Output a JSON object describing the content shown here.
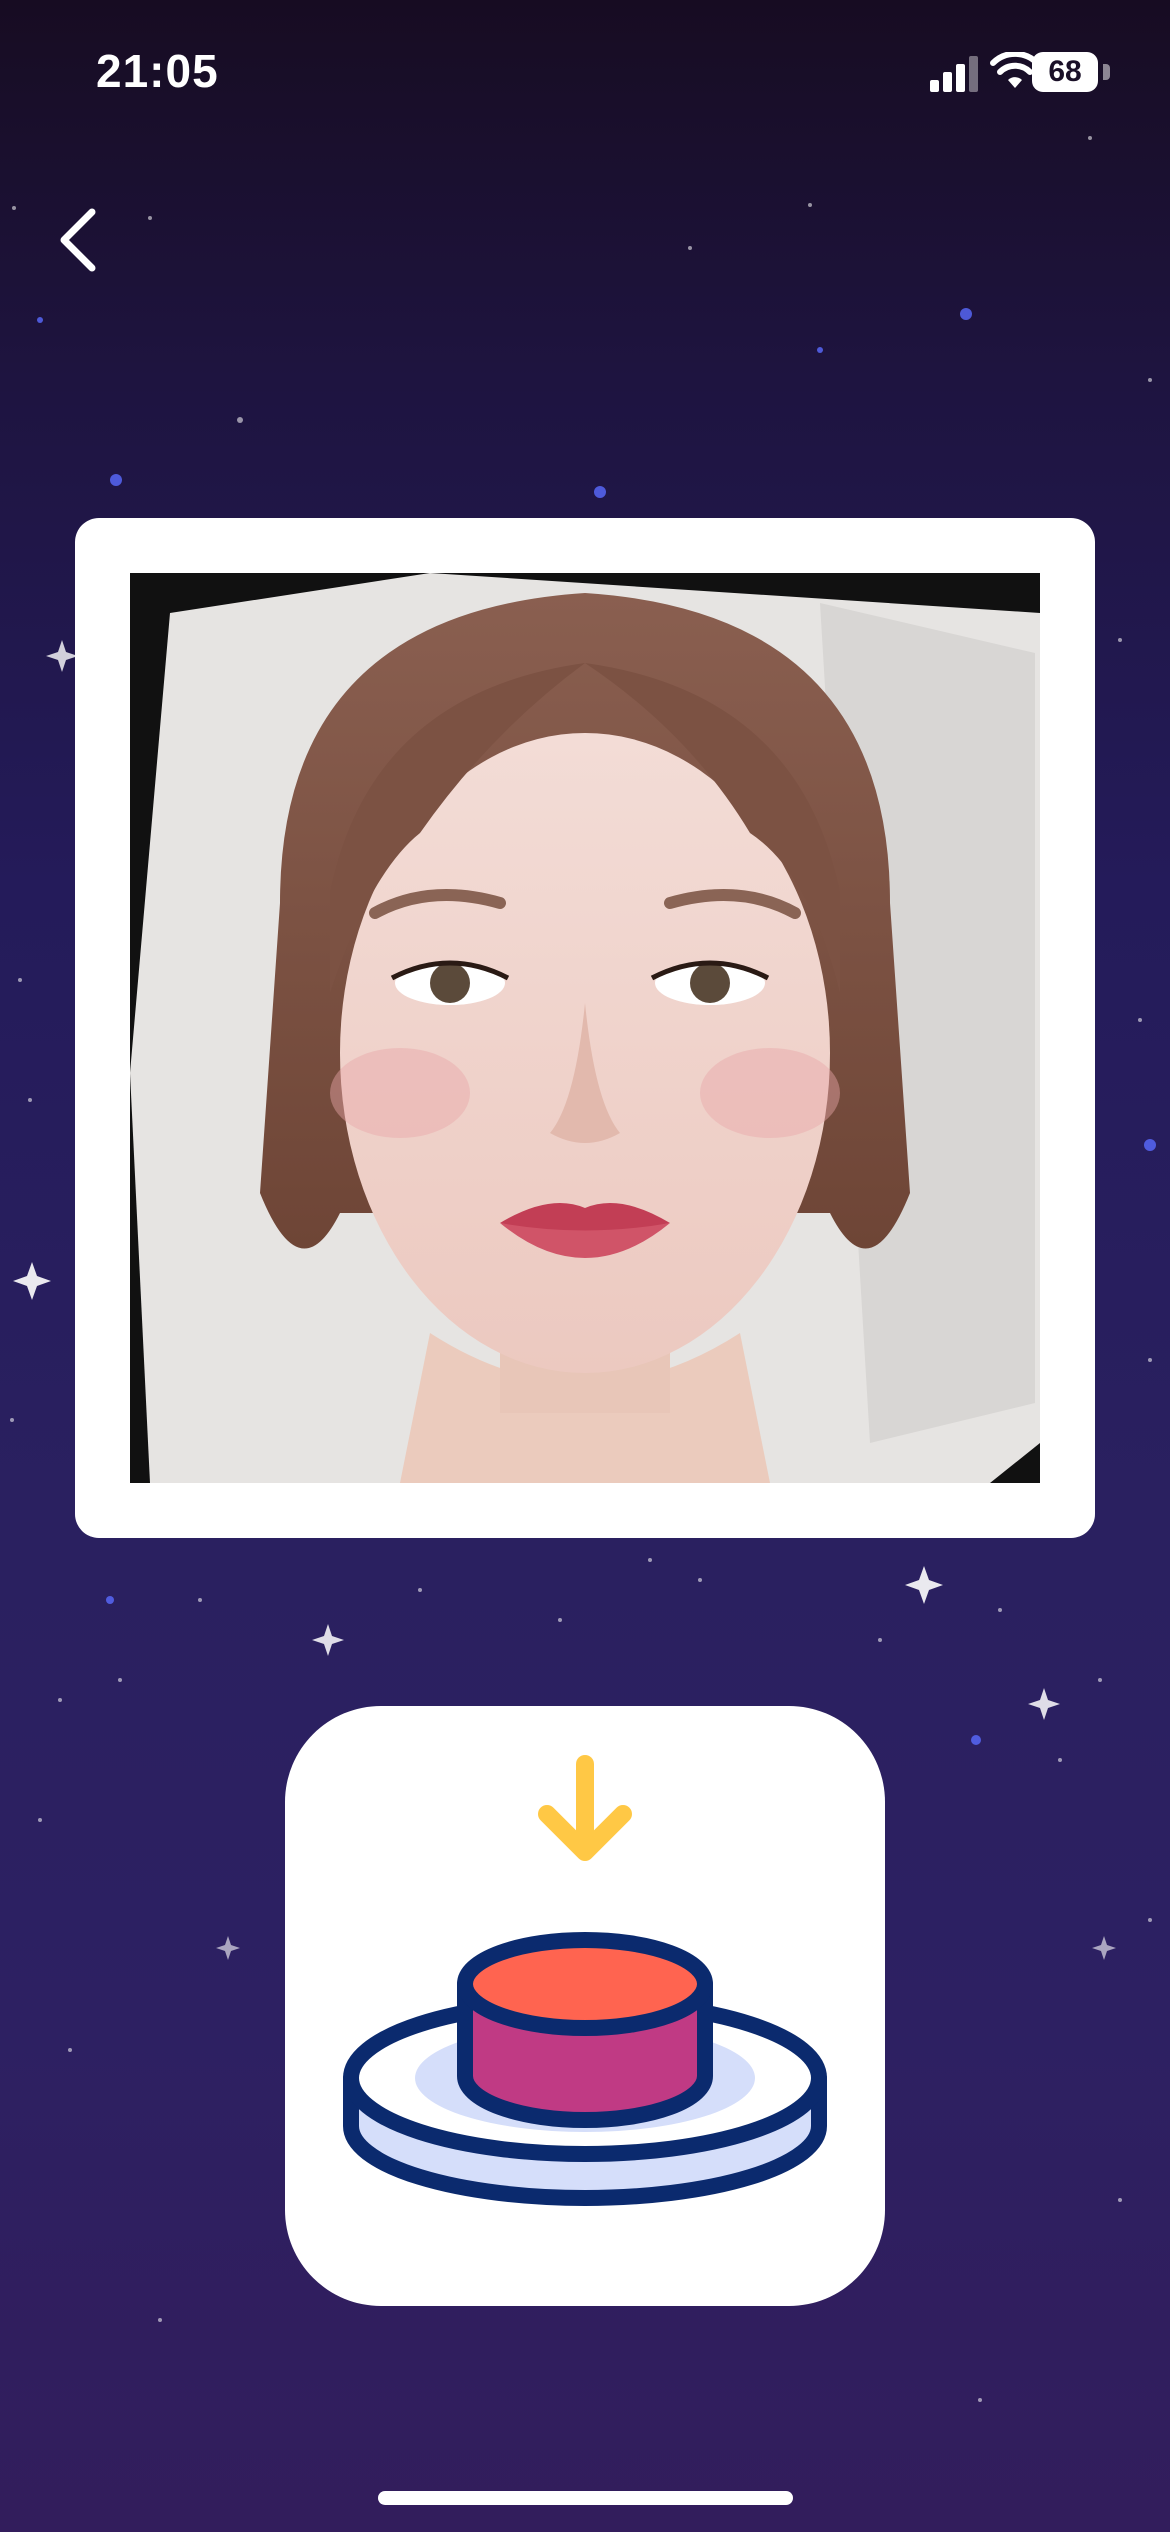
{
  "status_bar": {
    "time": "21:05",
    "battery_level": "68",
    "signal_icon": "cellular-signal-icon",
    "wifi_icon": "wifi-icon"
  },
  "nav": {
    "back_icon": "chevron-left-icon"
  },
  "photo": {
    "subject": "portrait-photo"
  },
  "action": {
    "icon": "press-button-icon",
    "arrow_icon": "arrow-down-icon",
    "colors": {
      "arrow": "#FFC845",
      "button_top": "#FF6450",
      "button_side": "#C03A84",
      "outline": "#0B2A6E",
      "base": "#D5DEFA"
    }
  },
  "theme": {
    "background_top": "#170C22",
    "background_bottom": "#321D5C"
  }
}
